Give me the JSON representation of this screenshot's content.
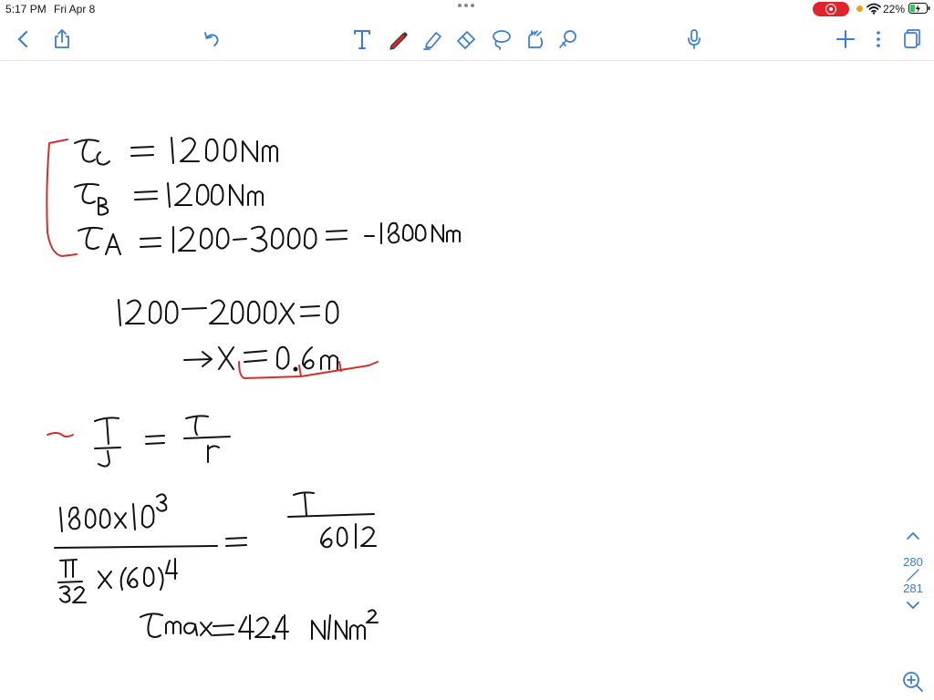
{
  "status": {
    "time": "5:17 PM",
    "date": "Fri Apr 8",
    "battery_percent": "22%"
  },
  "toolbar": {
    "left": [
      "back-icon",
      "share-icon",
      "undo-icon"
    ],
    "tools": [
      "text-tool-icon",
      "pen-icon",
      "highlighter-icon",
      "eraser-icon",
      "lasso-icon",
      "image-tool-icon",
      "shape-tool-icon"
    ],
    "right": [
      "microphone-icon",
      "add-icon",
      "more-icon",
      "pages-icon"
    ]
  },
  "colors": {
    "accent": "#3a7bd5",
    "ink": "#111111",
    "annotation": "#d32f2f",
    "record": "#e0242c"
  },
  "page_nav": {
    "current_page": "280",
    "total_pages": "281"
  }
}
